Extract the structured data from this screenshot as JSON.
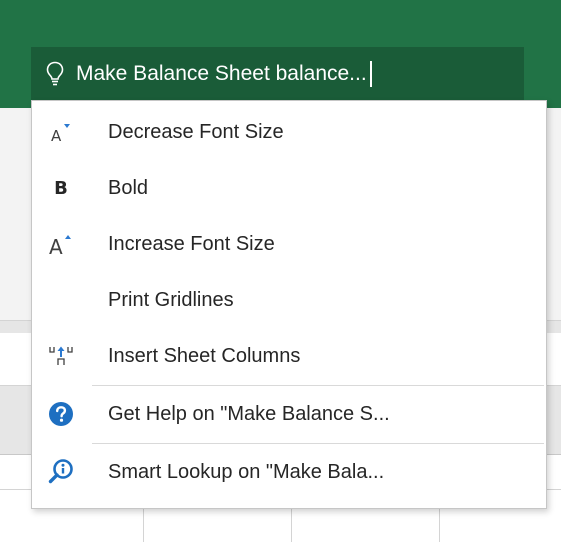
{
  "tell_me": {
    "query": "Make Balance Sheet balance..."
  },
  "menu": {
    "items": [
      {
        "label": "Decrease Font Size",
        "icon": "decrease-font-icon"
      },
      {
        "label": "Bold",
        "icon": "bold-icon"
      },
      {
        "label": "Increase Font Size",
        "icon": "increase-font-icon"
      },
      {
        "label": "Print Gridlines",
        "icon": ""
      },
      {
        "label": "Insert Sheet Columns",
        "icon": "insert-columns-icon"
      },
      {
        "label": "Get Help on \"Make Balance S...",
        "icon": "help-icon"
      },
      {
        "label": "Smart Lookup on \"Make Bala...",
        "icon": "smart-lookup-icon"
      }
    ]
  },
  "colors": {
    "ribbon_green": "#217346",
    "search_box": "#1a5c38",
    "icon_blue": "#2b79d0",
    "help_blue": "#1e6fc1"
  }
}
